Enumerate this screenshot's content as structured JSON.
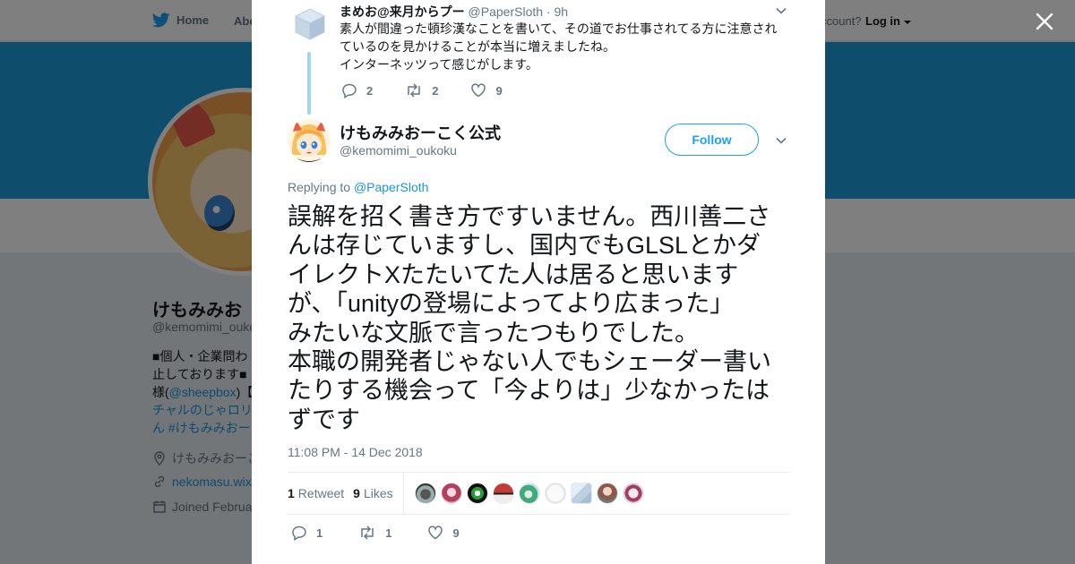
{
  "nav": {
    "home_label": "Home",
    "about_label": "Abo",
    "account_text": "ccount?",
    "login_label": "Log in"
  },
  "profile": {
    "name": "けもみみお",
    "handle": "@kemomimi_ouko",
    "bio": [
      "■個人・企業問わ",
      "止しております■",
      "様(",
      "@sheepbox",
      ")【",
      "チャルのじゃロリ",
      "ん #けもみみおー"
    ],
    "location": "けもみみおーこ",
    "link": "nekomasu.wix",
    "joined": "Joined Februa"
  },
  "parent_tweet": {
    "name": "まめお@来月からプー",
    "handle": "@PaperSloth",
    "time": "· 9h",
    "text_lines": [
      "素人が間違った頓珍漢なことを書いて、その道でお仕事されてる方に注意され",
      "ているのを見かけることが本当に増えましたね。",
      "インターネッツって感じがします。"
    ],
    "replies": "2",
    "retweets": "2",
    "likes": "9"
  },
  "tweet": {
    "name": "けもみみおーこく公式",
    "handle": "@kemomimi_oukoku",
    "follow_label": "Follow",
    "replying_prefix": "Replying to",
    "replying_to": "@PaperSloth",
    "text_lines": [
      "誤解を招く書き方ですいません。西川善二さ",
      "んは存じていますし、国内でもGLSLとかダ",
      "イレクトXたたいてた人は居ると思います",
      "が、「unityの登場によってより広まった」",
      "みたいな文脈で言ったつもりでした。",
      "本職の開発者じゃない人でもシェーダー書い",
      "たりする機会って「今よりは」少なかったは",
      "ずです"
    ],
    "timestamp": "11:08 PM - 14 Dec 2018",
    "retweet_count": "1",
    "retweet_label": "Retweet",
    "like_count": "9",
    "like_label": "Likes",
    "replies": "1",
    "retweets": "1",
    "likes": "9"
  },
  "colors": {
    "accent": "#1da1f2",
    "banner": "#1d9bd7",
    "text": "#14171a",
    "muted": "#657786"
  },
  "icons": {
    "close": "close-icon",
    "bird": "twitter-bird-icon",
    "chevron": "chevron-down-icon",
    "reply": "reply-icon",
    "retweet": "retweet-icon",
    "like": "heart-icon"
  }
}
